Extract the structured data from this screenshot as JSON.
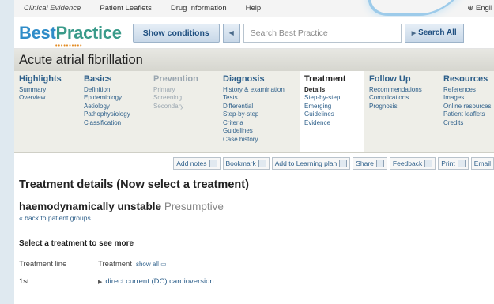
{
  "topnav": {
    "items": [
      "Clinical Evidence",
      "Patient Leaflets",
      "Drug Information",
      "Help"
    ],
    "language": "Engli"
  },
  "header": {
    "logo_part1": "Best",
    "logo_part2": "Practice",
    "show_conditions": "Show conditions",
    "search_placeholder": "Search Best Practice",
    "search_all": "Search All"
  },
  "topic": {
    "title": "Acute atrial fibrillation"
  },
  "tabs": [
    {
      "title": "Highlights",
      "items": [
        "Summary",
        "Overview"
      ],
      "state": "normal"
    },
    {
      "title": "Basics",
      "items": [
        "Definition",
        "Epidemiology",
        "Aetiology",
        "Pathophysiology",
        "Classification"
      ],
      "state": "normal"
    },
    {
      "title": "Prevention",
      "items": [
        "Primary",
        "Screening",
        "Secondary"
      ],
      "state": "muted"
    },
    {
      "title": "Diagnosis",
      "items": [
        "History & examination",
        "Tests",
        "Differential",
        "Step-by-step",
        "Criteria",
        "Guidelines",
        "Case history"
      ],
      "state": "normal"
    },
    {
      "title": "Treatment",
      "items": [
        "Details",
        "Step-by-step",
        "Emerging",
        "Guidelines",
        "Evidence"
      ],
      "state": "active"
    },
    {
      "title": "Follow Up",
      "items": [
        "Recommendations",
        "Complications",
        "Prognosis"
      ],
      "state": "normal"
    },
    {
      "title": "Resources",
      "items": [
        "References",
        "Images",
        "Online resources",
        "Patient leaflets",
        "Credits"
      ],
      "state": "normal"
    }
  ],
  "toolbar": [
    "Add notes",
    "Bookmark",
    "Add to Learning plan",
    "Share",
    "Feedback",
    "Print",
    "Email"
  ],
  "main": {
    "details_heading": "Treatment details (Now select a treatment)",
    "group": "haemodynamically unstable",
    "group_status": "Presumptive",
    "back_link": "« back to patient groups",
    "select_title": "Select a treatment to see more",
    "col_line": "Treatment line",
    "col_treatment": "Treatment",
    "show_all": "show all",
    "rows": [
      {
        "line": "1st",
        "treatment": "direct current (DC) cardioversion"
      }
    ]
  },
  "colors": {
    "brand_blue": "#2f8cc8",
    "link": "#2d5f8a",
    "tab_bg": "#eeeee8"
  }
}
